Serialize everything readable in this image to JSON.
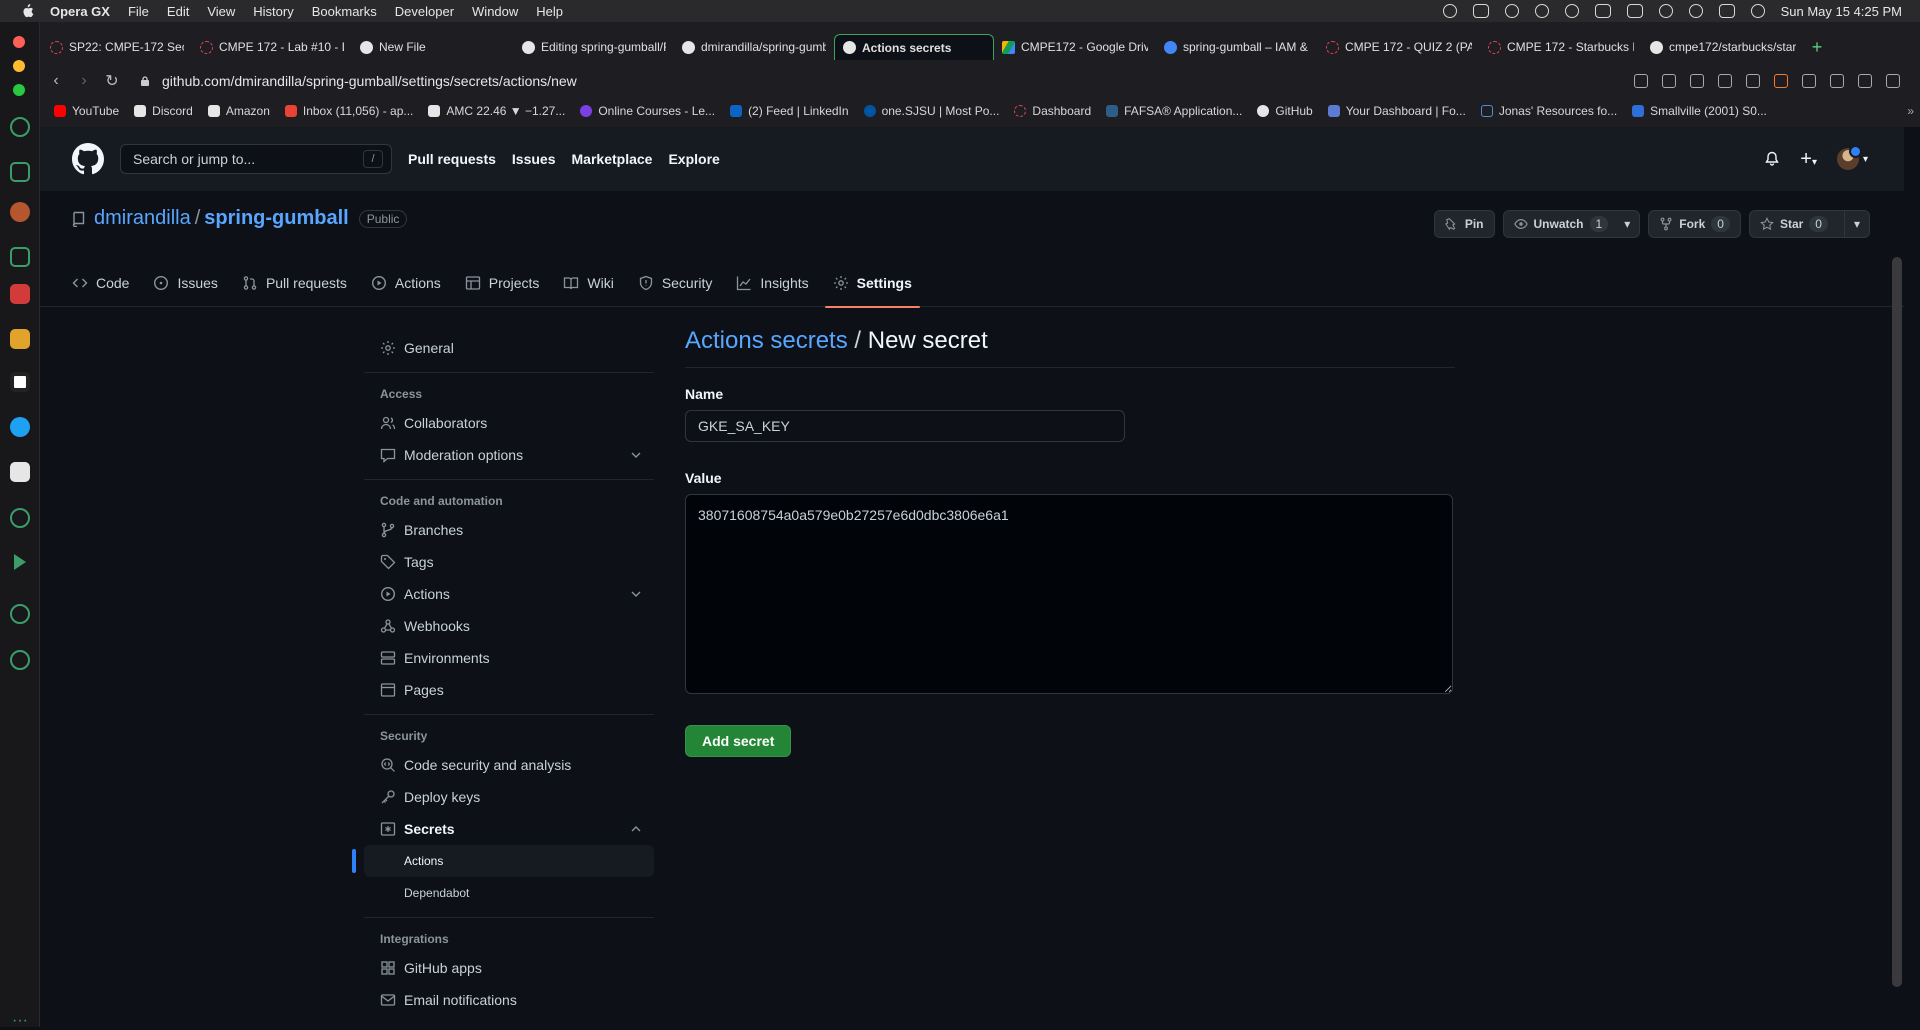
{
  "menubar": {
    "app": "Opera GX",
    "items": [
      "File",
      "Edit",
      "View",
      "History",
      "Bookmarks",
      "Developer",
      "Window",
      "Help"
    ],
    "clock": "Sun May 15  4:25 PM"
  },
  "browser": {
    "tabs": [
      {
        "label": "SP22: CMPE-172 Sec 01",
        "icon": "canvas-icon"
      },
      {
        "label": "CMPE 172 - Lab #10 - D",
        "icon": "canvas-icon"
      },
      {
        "label": "New File",
        "icon": "github-icon"
      },
      {
        "label": "Editing spring-gumball/R",
        "icon": "github-icon"
      },
      {
        "label": "dmirandilla/spring-gumb",
        "icon": "github-icon"
      },
      {
        "label": "Actions secrets",
        "icon": "github-icon",
        "active": true
      },
      {
        "label": "CMPE172 - Google Drive",
        "icon": "drive-icon"
      },
      {
        "label": "spring-gumball – IAM & A",
        "icon": "gcloud-icon"
      },
      {
        "label": "CMPE 172 - QUIZ 2 (PAR",
        "icon": "canvas-icon"
      },
      {
        "label": "CMPE 172 - Starbucks Pr",
        "icon": "canvas-icon"
      },
      {
        "label": "cmpe172/starbucks/start",
        "icon": "github-icon"
      }
    ],
    "url": "github.com/dmirandilla/spring-gumball/settings/secrets/actions/new",
    "bookmarks": [
      {
        "label": "YouTube",
        "color": "#ff0000"
      },
      {
        "label": "Discord",
        "color": "#e6e6e6"
      },
      {
        "label": "Amazon",
        "color": "#e6e6e6"
      },
      {
        "label": "Inbox (11,056) - ap...",
        "color": "#ea4335"
      },
      {
        "label": "AMC 22.46 ▼ −1.27...",
        "color": "#e6e6e6"
      },
      {
        "label": "Online Courses - Le...",
        "color": "#7b3fe4"
      },
      {
        "label": "(2) Feed | LinkedIn",
        "color": "#0a66c2"
      },
      {
        "label": "one.SJSU | Most Po...",
        "color": "#0055a2"
      },
      {
        "label": "Dashboard",
        "color": "#e2444f"
      },
      {
        "label": "FAFSA® Application...",
        "color": "#2d5e8a"
      },
      {
        "label": "GitHub",
        "color": "#e6e6e6"
      },
      {
        "label": "Your Dashboard | Fo...",
        "color": "#5b7bd5"
      },
      {
        "label": "Jonas' Resources fo...",
        "color": "#4a90d9"
      },
      {
        "label": "Smallville (2001) S0...",
        "color": "#2f6fd8"
      }
    ]
  },
  "github": {
    "search_placeholder": "Search or jump to...",
    "search_key": "/",
    "nav": [
      "Pull requests",
      "Issues",
      "Marketplace",
      "Explore"
    ],
    "repo": {
      "owner": "dmirandilla",
      "sep": "/",
      "name": "spring-gumball",
      "visibility": "Public"
    },
    "repo_buttons": {
      "pin": "Pin",
      "unwatch": "Unwatch",
      "unwatch_count": "1",
      "fork": "Fork",
      "fork_count": "0",
      "star": "Star",
      "star_count": "0"
    },
    "repo_tabs": [
      {
        "label": "Code",
        "icon": "code-icon"
      },
      {
        "label": "Issues",
        "icon": "issue-icon"
      },
      {
        "label": "Pull requests",
        "icon": "pull-request-icon"
      },
      {
        "label": "Actions",
        "icon": "play-icon"
      },
      {
        "label": "Projects",
        "icon": "table-icon"
      },
      {
        "label": "Wiki",
        "icon": "book-icon"
      },
      {
        "label": "Security",
        "icon": "shield-icon"
      },
      {
        "label": "Insights",
        "icon": "graph-icon"
      },
      {
        "label": "Settings",
        "icon": "gear-icon",
        "selected": true
      }
    ]
  },
  "settings_nav": {
    "general": "General",
    "access_heading": "Access",
    "collaborators": "Collaborators",
    "moderation": "Moderation options",
    "code_heading": "Code and automation",
    "branches": "Branches",
    "tags": "Tags",
    "actions": "Actions",
    "webhooks": "Webhooks",
    "environments": "Environments",
    "pages": "Pages",
    "security_heading": "Security",
    "code_security": "Code security and analysis",
    "deploy_keys": "Deploy keys",
    "secrets": "Secrets",
    "secrets_actions": "Actions",
    "secrets_dependabot": "Dependabot",
    "integrations_heading": "Integrations",
    "github_apps": "GitHub apps",
    "email_notifications": "Email notifications"
  },
  "form": {
    "crumb": "Actions secrets",
    "crumb_sep": " / ",
    "title": "New secret",
    "name_label": "Name",
    "name_value": "GKE_SA_KEY",
    "value_label": "Value",
    "value_value": "38071608754a0a579e0b27257e6d0dbc3806e6a1",
    "submit": "Add secret"
  }
}
